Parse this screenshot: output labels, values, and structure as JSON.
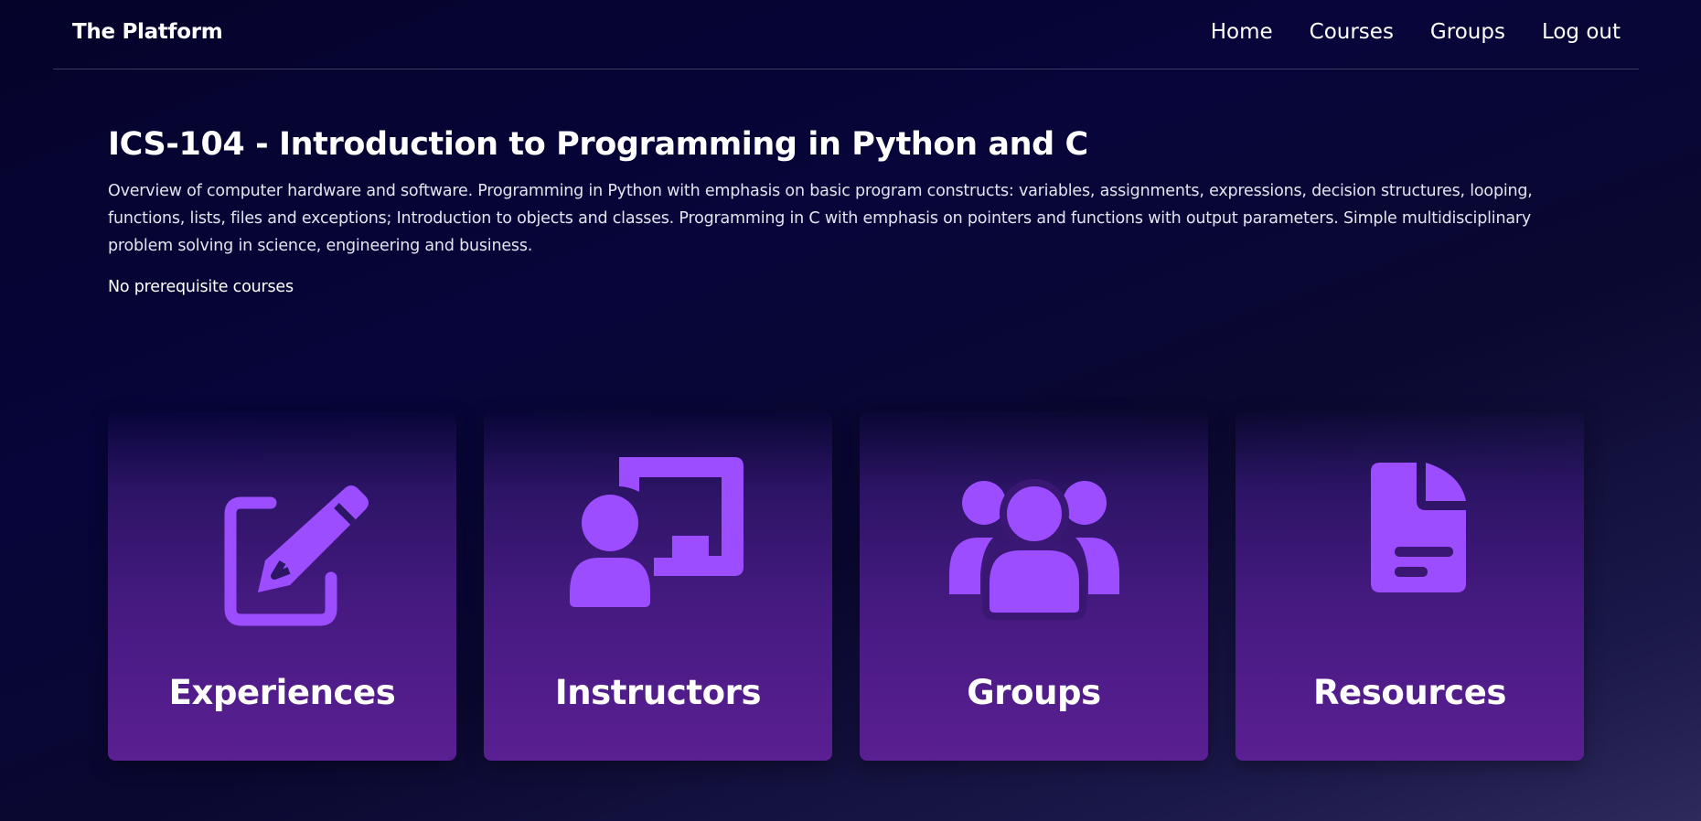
{
  "brand": "The Platform",
  "nav": {
    "items": [
      {
        "label": "Home"
      },
      {
        "label": "Courses"
      },
      {
        "label": "Groups"
      },
      {
        "label": "Log out"
      }
    ]
  },
  "course": {
    "title": "ICS-104 - Introduction to Programming in Python and C",
    "description": "Overview of computer hardware and software. Programming in Python with emphasis on basic program constructs: variables, assignments, expressions, decision structures, looping, functions, lists, files and exceptions; Introduction to objects and classes. Programming in C with emphasis on pointers and functions with output parameters. Simple multidisciplinary problem solving in science, engineering and business.",
    "prerequisites": "No prerequisite courses"
  },
  "cards": [
    {
      "label": "Experiences",
      "icon": "pencil-square-icon"
    },
    {
      "label": "Instructors",
      "icon": "chalkboard-teacher-icon"
    },
    {
      "label": "Groups",
      "icon": "users-icon"
    },
    {
      "label": "Resources",
      "icon": "file-lines-icon"
    }
  ],
  "colors": {
    "accent": "#9b4dff",
    "card_top": "#2c1465",
    "card_bottom": "#5a1f92",
    "background": "#07053a"
  }
}
